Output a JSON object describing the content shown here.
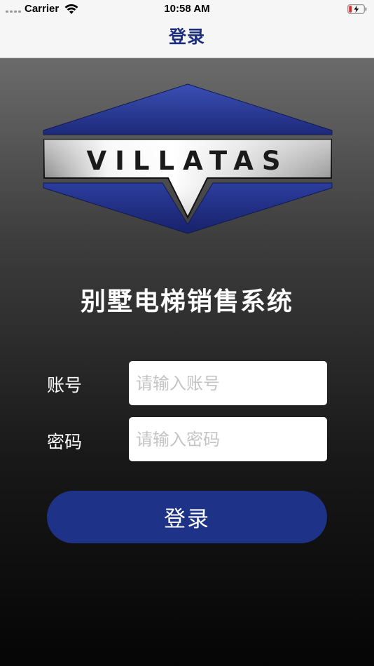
{
  "status_bar": {
    "carrier": "Carrier",
    "time": "10:58 AM"
  },
  "nav": {
    "title": "登录"
  },
  "logo": {
    "text": "VILLATAS",
    "accent_color": "#2f3f9e"
  },
  "app": {
    "title": "别墅电梯销售系统"
  },
  "form": {
    "account_label": "账号",
    "account_placeholder": "请输入账号",
    "account_value": "",
    "password_label": "密码",
    "password_placeholder": "请输入密码",
    "password_value": "",
    "login_button": "登录"
  },
  "colors": {
    "nav_title": "#1e2e7d",
    "button": "#1e3287",
    "battery_low": "#e0292b"
  }
}
